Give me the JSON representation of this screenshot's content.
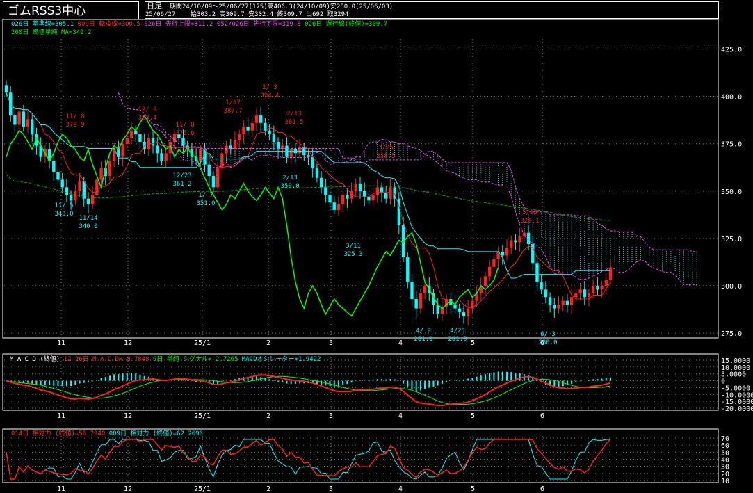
{
  "header": {
    "title": "ゴムRSS3中心",
    "period_label": "日足",
    "period_info": "期間24/10/09～25/06/27(175)高406.3(24/10/09)安280.0(25/06/03)",
    "date": "25/06/27",
    "quote": "始303.2 高309.7 安302.4 終309.7 出692 取3294"
  },
  "legend_main": {
    "line1": [
      {
        "text": "026日 基準線=305.1",
        "color": "#00ffff"
      },
      {
        "text": "009日 転換線=300.5",
        "color": "#ff3030"
      },
      {
        "text": "026日 先行上限=311.2",
        "color": "#ff40ff"
      },
      {
        "text": "052/026日 先行下限=319.8",
        "color": "#ff40ff"
      },
      {
        "text": "026日 遅行線(終値)=309.7",
        "color": "#00ff00"
      }
    ],
    "line2": [
      {
        "text": "200日 終値単純 MA=349.2",
        "color": "#00ff00"
      }
    ]
  },
  "legend_macd": [
    {
      "text": "M A C D (終値)",
      "color": "#ffffff"
    },
    {
      "text": "12-26日 M A C D=-0.7848",
      "color": "#ff3030"
    },
    {
      "text": "9日 単純 シグナル=-2.7265",
      "color": "#00ff00"
    },
    {
      "text": "MACDオシレーター=1.9422",
      "color": "#00ffff"
    }
  ],
  "legend_rsi": [
    {
      "text": "014日 相対力 (終値)=56.7940",
      "color": "#ff3030"
    },
    {
      "text": "009日 相対力 (終値)=62.2696",
      "color": "#00ffff"
    }
  ],
  "colors": {
    "up": "#ff2020",
    "down": "#00ffff",
    "kumo": "#ff40ff",
    "lagging": "#00ff00",
    "ma": "#00aa00"
  },
  "chart_data": [
    {
      "type": "candlestick",
      "panel": "price",
      "x_ticks": [
        "11",
        "12",
        "25/1",
        "2",
        "3",
        "4",
        "5",
        "6"
      ],
      "y_ticks": [
        "275.0",
        "300.0",
        "325.0",
        "350.0",
        "375.0",
        "400.0",
        "425.0"
      ],
      "ylim": [
        275,
        430
      ],
      "closes": [
        402,
        390,
        385,
        392,
        384,
        388,
        380,
        374,
        368,
        372,
        366,
        360,
        356,
        352,
        348,
        345,
        350,
        355,
        346,
        343,
        348,
        356,
        362,
        358,
        366,
        372,
        368,
        375,
        378,
        382,
        380,
        376,
        372,
        378,
        374,
        370,
        366,
        370,
        376,
        380,
        378,
        374,
        372,
        368,
        366,
        372,
        364,
        358,
        352,
        362,
        370,
        374,
        372,
        377,
        380,
        384,
        382,
        386,
        390,
        386,
        382,
        380,
        376,
        372,
        374,
        368,
        372,
        370,
        373,
        369,
        368,
        362,
        357,
        352,
        348,
        344,
        340,
        343,
        348,
        346,
        350,
        354,
        350,
        347,
        345,
        348,
        352,
        349,
        346,
        352,
        346,
        332,
        315,
        302,
        293,
        288,
        296,
        300,
        296,
        290,
        285,
        289,
        293,
        290,
        288,
        286,
        284,
        288,
        292,
        296,
        300,
        305,
        310,
        314,
        318,
        316,
        320,
        324,
        323,
        326,
        328,
        322,
        312,
        302,
        298,
        294,
        290,
        288,
        290,
        292,
        290,
        294,
        296,
        298,
        294,
        296,
        300,
        298,
        300,
        303,
        309.7
      ],
      "annotations": [
        {
          "text": "11/ 8",
          "value": "379.9",
          "kind": "high"
        },
        {
          "text": "11/ 5",
          "value": "343.0",
          "kind": "low"
        },
        {
          "text": "11/14",
          "value": "340.0",
          "kind": "low"
        },
        {
          "text": "12/ 9",
          "value": "383.4",
          "kind": "high"
        },
        {
          "text": "11/ 8",
          "value": "375.6",
          "kind": "high"
        },
        {
          "text": "12/23",
          "value": "361.2",
          "kind": "low"
        },
        {
          "text": "1/ 7",
          "value": "351.0",
          "kind": "low"
        },
        {
          "text": "1/17",
          "value": "387.7",
          "kind": "high"
        },
        {
          "text": "2/ 3",
          "value": "394.4",
          "kind": "high"
        },
        {
          "text": "2/13",
          "value": "381.5",
          "kind": "high"
        },
        {
          "text": "2/13",
          "value": "350.0",
          "kind": "low"
        },
        {
          "text": "3/25",
          "value": "358.5",
          "kind": "high"
        },
        {
          "text": "3/11",
          "value": "325.3",
          "kind": "low"
        },
        {
          "text": "4/ 9",
          "value": "281.0",
          "kind": "low"
        },
        {
          "text": "4/23",
          "value": "281.0",
          "kind": "low"
        },
        {
          "text": "5/23",
          "value": "329.1",
          "kind": "high"
        },
        {
          "text": "6/ 3",
          "value": "280.0",
          "kind": "low"
        }
      ]
    },
    {
      "type": "line",
      "panel": "macd",
      "y_ticks": [
        "15.0000",
        "10.0000",
        "5.0000",
        "0",
        "-5.0000",
        "-10.0000",
        "-15.0000",
        "-20.0000"
      ],
      "ylim": [
        -20,
        15
      ]
    },
    {
      "type": "line",
      "panel": "rsi",
      "y_ticks": [
        "70",
        "60",
        "50",
        "40",
        "30",
        "20",
        "10"
      ],
      "ylim": [
        10,
        70
      ]
    }
  ]
}
